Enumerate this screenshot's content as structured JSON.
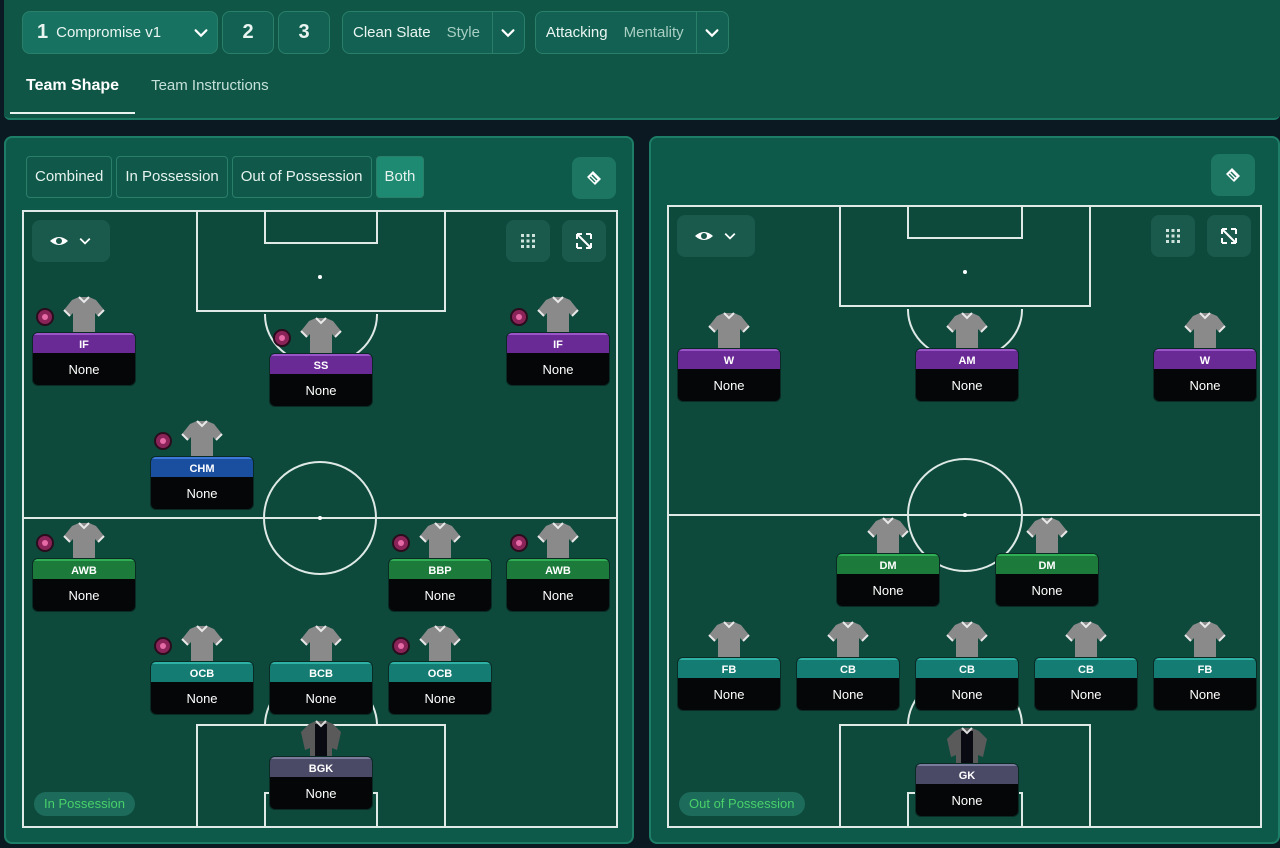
{
  "tactics": [
    {
      "num": "1",
      "label": "Compromise v1",
      "active": true
    },
    {
      "num": "2"
    },
    {
      "num": "3"
    }
  ],
  "style": {
    "value": "Clean Slate",
    "label": "Style"
  },
  "mentality": {
    "value": "Attacking",
    "label": "Mentality"
  },
  "tabs": [
    {
      "label": "Team Shape",
      "active": true
    },
    {
      "label": "Team Instructions"
    }
  ],
  "phase_filters": [
    "Combined",
    "In Possession",
    "Out of Possession",
    "Both"
  ],
  "left_panel": {
    "badge": "In Possession",
    "players": [
      {
        "role": "IF",
        "name": "None",
        "color": "purple",
        "badge": true
      },
      {
        "role": "SS",
        "name": "None",
        "color": "purple",
        "badge": true
      },
      {
        "role": "IF",
        "name": "None",
        "color": "purple",
        "badge": true
      },
      {
        "role": "CHM",
        "name": "None",
        "color": "blue",
        "badge": true
      },
      {
        "role": "AWB",
        "name": "None",
        "color": "green",
        "badge": true
      },
      {
        "role": "BBP",
        "name": "None",
        "color": "green",
        "badge": true
      },
      {
        "role": "AWB",
        "name": "None",
        "color": "green",
        "badge": true
      },
      {
        "role": "OCB",
        "name": "None",
        "color": "teal",
        "badge": true
      },
      {
        "role": "BCB",
        "name": "None",
        "color": "teal",
        "badge": false
      },
      {
        "role": "OCB",
        "name": "None",
        "color": "teal",
        "badge": true
      },
      {
        "role": "BGK",
        "name": "None",
        "color": "gk",
        "badge": false,
        "gk": true
      }
    ]
  },
  "right_panel": {
    "badge": "Out of Possession",
    "players": [
      {
        "role": "W",
        "name": "None",
        "color": "purple"
      },
      {
        "role": "AM",
        "name": "None",
        "color": "purple"
      },
      {
        "role": "W",
        "name": "None",
        "color": "purple"
      },
      {
        "role": "DM",
        "name": "None",
        "color": "green"
      },
      {
        "role": "DM",
        "name": "None",
        "color": "green"
      },
      {
        "role": "FB",
        "name": "None",
        "color": "teal"
      },
      {
        "role": "CB",
        "name": "None",
        "color": "teal"
      },
      {
        "role": "CB",
        "name": "None",
        "color": "teal"
      },
      {
        "role": "CB",
        "name": "None",
        "color": "teal"
      },
      {
        "role": "FB",
        "name": "None",
        "color": "teal"
      },
      {
        "role": "GK",
        "name": "None",
        "color": "gk",
        "gk": true
      }
    ]
  },
  "colors": {
    "purple": "#6a2a96",
    "blue": "#1a4fa0",
    "green": "#1c7a3a",
    "teal": "#157c73",
    "gk": "#4a4a66"
  }
}
